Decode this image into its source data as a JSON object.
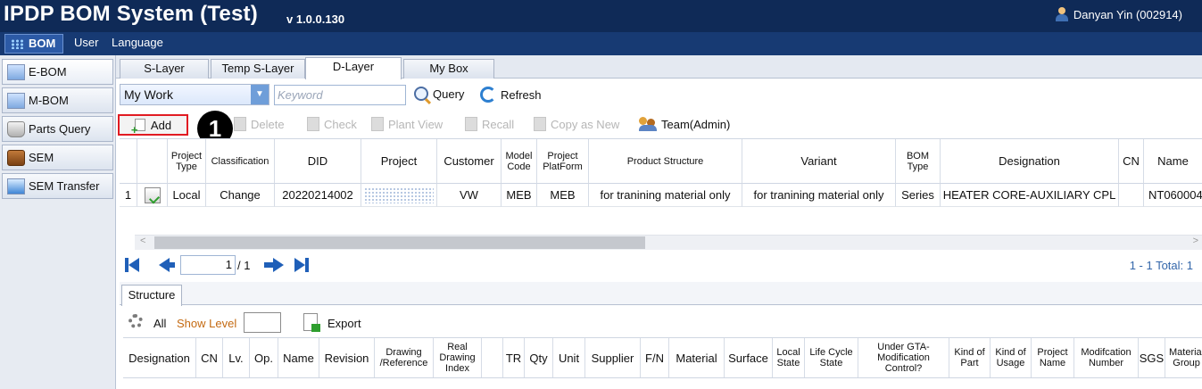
{
  "app": {
    "title": "IPDP BOM System (Test)",
    "version": "v 1.0.0.130",
    "user": "Danyan Yin (002914)"
  },
  "menu": {
    "bom": "BOM",
    "user": "User",
    "language": "Language"
  },
  "sidebar": {
    "items": [
      "E-BOM",
      "M-BOM",
      "Parts Query",
      "SEM",
      "SEM Transfer"
    ]
  },
  "tabs": [
    "S-Layer",
    "Temp S-Layer",
    "D-Layer",
    "My Box"
  ],
  "filter": {
    "scope": "My Work",
    "keyword_placeholder": "Keyword",
    "query": "Query",
    "refresh": "Refresh"
  },
  "actions": {
    "add": "Add",
    "delete": "Delete",
    "check": "Check",
    "plant_view": "Plant View",
    "recall": "Recall",
    "copy_as_new": "Copy as New",
    "team": "Team(Admin)"
  },
  "callout": "1",
  "grid": {
    "headers": [
      "Project Type",
      "Classification",
      "DID",
      "Project",
      "Customer",
      "Model Code",
      "Project PlatForm",
      "Product Structure",
      "Variant",
      "BOM Type",
      "Designation",
      "CN",
      "Name"
    ],
    "rows": [
      {
        "num": "1",
        "project_type": "Local",
        "classification": "Change",
        "did": "20220214002",
        "project": "",
        "customer": "VW",
        "model_code": "MEB",
        "platform": "MEB",
        "product_structure": "for tranining material only",
        "variant": "for tranining material only",
        "bom_type": "Series",
        "designation": "HEATER CORE-AUXILIARY CPL",
        "cn": "",
        "name": "NT060004"
      }
    ]
  },
  "pager": {
    "page": "1",
    "total": "/ 1",
    "range": "1 - 1  Total: 1"
  },
  "structure": {
    "tab": "Structure",
    "all": "All",
    "show_level": "Show Level",
    "export": "Export",
    "headers": [
      "Designation",
      "CN",
      "Lv.",
      "Op.",
      "Name",
      "Revision",
      "Drawing /Reference",
      "Real Drawing Index",
      "",
      "TR",
      "Qty",
      "Unit",
      "Supplier",
      "F/N",
      "Material",
      "Surface",
      "Local State",
      "Life Cycle State",
      "Under GTA-Modification Control?",
      "Kind of Part",
      "Kind of Usage",
      "Project Name",
      "Modifcation Number",
      "SGS",
      "Material Group"
    ]
  }
}
